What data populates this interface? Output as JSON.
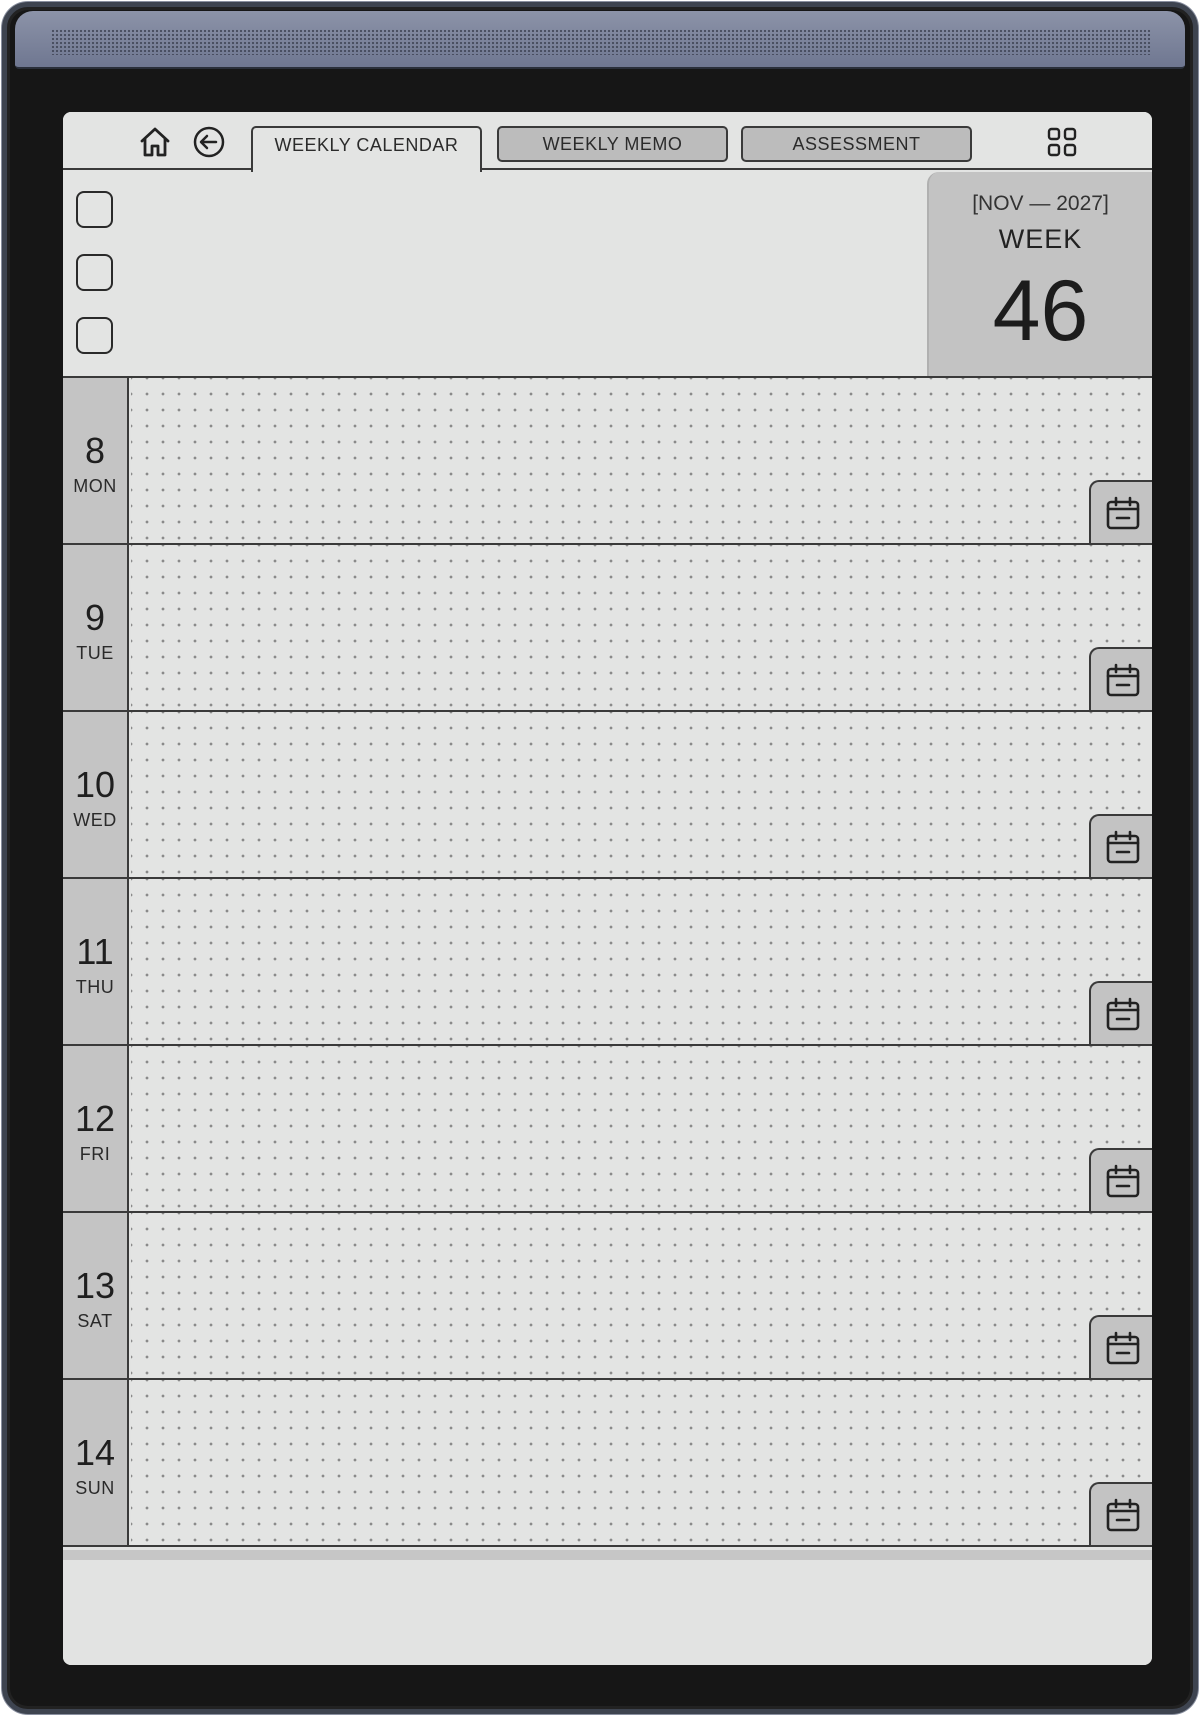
{
  "tabs": {
    "weekly_calendar": "WEEKLY CALENDAR",
    "weekly_memo": "WEEKLY MEMO",
    "assessment": "ASSESSMENT"
  },
  "icons": {
    "home": "home-icon",
    "back": "arrow-left-circle-icon",
    "grid": "grid-icon",
    "calendar": "calendar-icon"
  },
  "week": {
    "range": "[NOV — 2027]",
    "label": "WEEK",
    "number": "46"
  },
  "days": [
    {
      "num": "8",
      "name": "MON"
    },
    {
      "num": "9",
      "name": "TUE"
    },
    {
      "num": "10",
      "name": "WED"
    },
    {
      "num": "11",
      "name": "THU"
    },
    {
      "num": "12",
      "name": "FRI"
    },
    {
      "num": "13",
      "name": "SAT"
    },
    {
      "num": "14",
      "name": "SUN"
    }
  ],
  "colors": {
    "screen": "#e3e4e3",
    "panel": "#c3c3c3",
    "frame": "#161616",
    "bezel_accent": "#7a8299"
  }
}
